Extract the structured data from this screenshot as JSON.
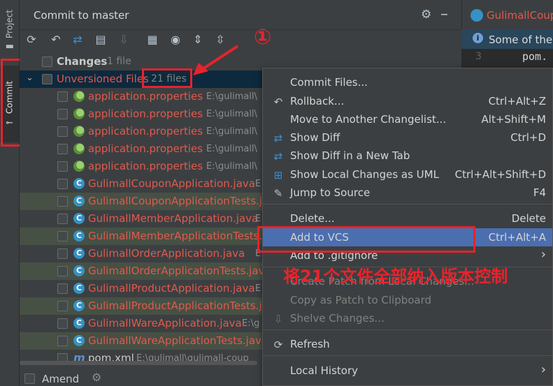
{
  "stripe": {
    "project_label": "Project",
    "commit_label": "Commit"
  },
  "panel": {
    "title": "Commit to master"
  },
  "tree": {
    "changes": {
      "label": "Changes",
      "count": "1 file"
    },
    "unversioned": {
      "label": "Unversioned Files",
      "count": "21 files"
    },
    "files": [
      {
        "name": "application.properties",
        "path": "E:\\gulimall\\",
        "icon": "spring-leaf-icon",
        "hl": false
      },
      {
        "name": "application.properties",
        "path": "E:\\gulimall\\",
        "icon": "spring-leaf-icon",
        "hl": false
      },
      {
        "name": "application.properties",
        "path": "E:\\gulimall\\",
        "icon": "spring-leaf-icon",
        "hl": false
      },
      {
        "name": "application.properties",
        "path": "E:\\gulimall\\",
        "icon": "spring-leaf-icon",
        "hl": false
      },
      {
        "name": "application.properties",
        "path": "E:\\gulimall\\",
        "icon": "spring-leaf-icon",
        "hl": false
      },
      {
        "name": "GulimallCouponApplication.java",
        "path": "E",
        "icon": "java-class-icon",
        "hl": false
      },
      {
        "name": "GulimallCouponApplicationTests.java",
        "path": "",
        "icon": "java-class-icon",
        "hl": true
      },
      {
        "name": "GulimallMemberApplication.java",
        "path": "E",
        "icon": "java-class-icon",
        "hl": false
      },
      {
        "name": "GulimallMemberApplicationTests.java",
        "path": "",
        "icon": "java-class-icon",
        "hl": true
      },
      {
        "name": "GulimallOrderApplication.java",
        "path": "E",
        "icon": "java-class-icon",
        "hl": false
      },
      {
        "name": "GulimallOrderApplicationTests.java",
        "path": "",
        "icon": "java-class-icon",
        "hl": true
      },
      {
        "name": "GulimallProductApplication.java",
        "path": "E",
        "icon": "java-class-icon",
        "hl": false
      },
      {
        "name": "GulimallProductApplicationTests.java",
        "path": "",
        "icon": "java-class-icon",
        "hl": true
      },
      {
        "name": "GulimallWareApplication.java",
        "path": "E:\\g",
        "icon": "java-class-icon",
        "hl": false
      },
      {
        "name": "GulimallWareApplicationTests.java",
        "path": "",
        "icon": "java-class-icon",
        "hl": true
      },
      {
        "name": "pom.xml",
        "path": "E:\\gulimall\\gulimall-coup",
        "icon": "maven-icon",
        "hl": false
      }
    ]
  },
  "bottom": {
    "amend_label": "Amend"
  },
  "editor": {
    "tab_label": "GulimallCoup",
    "banner_text": "Some of the",
    "line_no": "3",
    "line_text": "pom."
  },
  "menu": {
    "items": [
      {
        "label": "Commit Files...",
        "shortcut": "",
        "icon": "",
        "disabled": false
      },
      {
        "label": "Rollback...",
        "shortcut": "Ctrl+Alt+Z",
        "icon": "rollback-icon",
        "disabled": false
      },
      {
        "label": "Move to Another Changelist...",
        "shortcut": "Alt+Shift+M",
        "icon": "",
        "disabled": false
      },
      {
        "label": "Show Diff",
        "shortcut": "Ctrl+D",
        "icon": "diff-icon",
        "disabled": false
      },
      {
        "label": "Show Diff in a New Tab",
        "shortcut": "",
        "icon": "diff-icon",
        "disabled": false
      },
      {
        "label": "Show Local Changes as UML",
        "shortcut": "Ctrl+Alt+Shift+D",
        "icon": "uml-icon",
        "disabled": false
      },
      {
        "label": "Jump to Source",
        "shortcut": "F4",
        "icon": "pencil-icon",
        "disabled": false
      },
      {
        "label": "Delete...",
        "shortcut": "Delete",
        "icon": "",
        "disabled": false
      },
      {
        "label": "Add to VCS",
        "shortcut": "Ctrl+Alt+A",
        "icon": "",
        "disabled": false
      },
      {
        "label": "Add to .gitignore",
        "shortcut": "",
        "icon": "",
        "disabled": false
      },
      {
        "label": "Create Patch from Local Changes...",
        "shortcut": "",
        "icon": "",
        "disabled": true
      },
      {
        "label": "Copy as Patch to Clipboard",
        "shortcut": "",
        "icon": "",
        "disabled": true
      },
      {
        "label": "Shelve Changes...",
        "shortcut": "",
        "icon": "shelve-icon",
        "disabled": true
      },
      {
        "label": "Refresh",
        "shortcut": "",
        "icon": "refresh-icon",
        "disabled": false
      },
      {
        "label": "Local History",
        "shortcut": "",
        "icon": "",
        "disabled": false
      }
    ]
  },
  "annotation": {
    "number": "①",
    "text": "将21个文件全部纳入版本控制"
  },
  "colors": {
    "annotation_red": "#e8232b",
    "selected_menu": "#4b6eaf",
    "unversioned_red": "#e05a4e"
  }
}
